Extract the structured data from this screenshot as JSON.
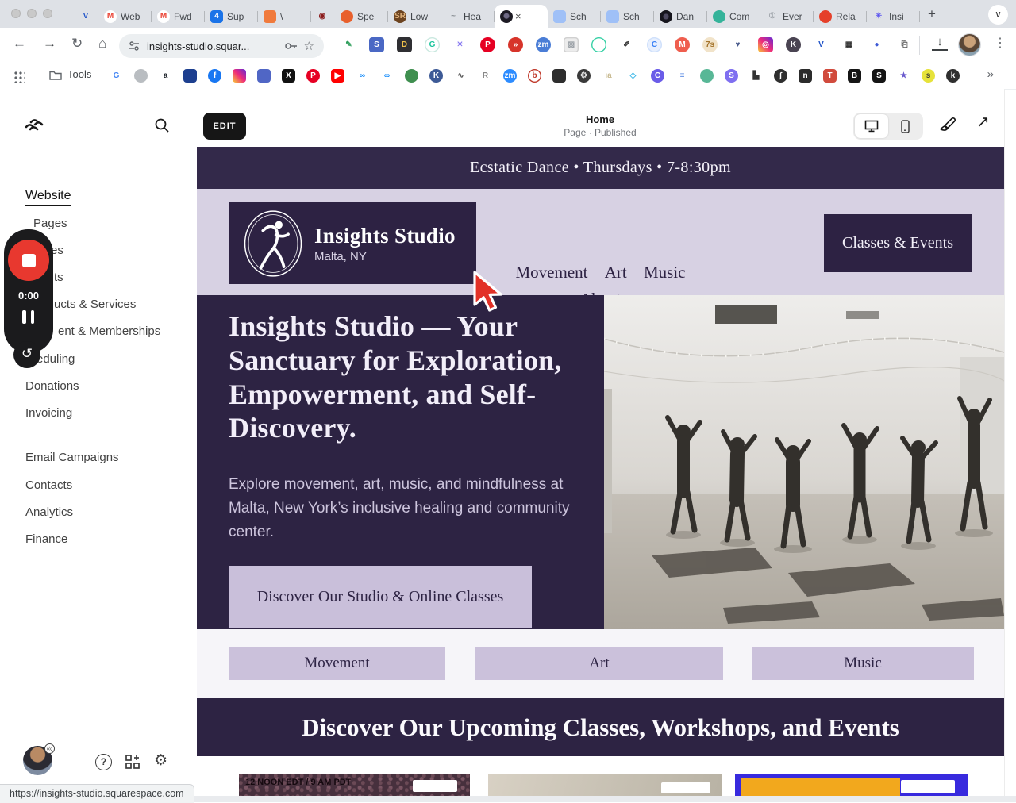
{
  "browser": {
    "tabs": [
      {
        "name": "pinned-tab-v",
        "glyph": "V",
        "fg": "#2456c9",
        "bg": "transparent",
        "label": "",
        "pinned": true
      },
      {
        "name": "tab-gmail-web",
        "glyph": "M",
        "fg": "#ea4335",
        "bg": "#ffffff",
        "label": "Web"
      },
      {
        "name": "tab-gmail-fwd",
        "glyph": "M",
        "fg": "#ea4335",
        "bg": "#ffffff",
        "label": "Fwd"
      },
      {
        "name": "tab-calendar-sup",
        "glyph": "4",
        "fg": "#ffffff",
        "bg": "#1a73e8",
        "sq": true,
        "label": "Sup"
      },
      {
        "name": "tab-orange-doc",
        "glyph": "",
        "fg": "#ffffff",
        "bg": "#f07a3c",
        "sq": true,
        "label": "\\"
      },
      {
        "name": "pinned-tab-record",
        "glyph": "◉",
        "fg": "#8b1c1c",
        "bg": "transparent",
        "label": "",
        "pinned": true
      },
      {
        "name": "tab-chat-spe",
        "glyph": "",
        "fg": "#ffffff",
        "bg": "#e8602c",
        "label": "Spe"
      },
      {
        "name": "tab-sr-low",
        "glyph": "SR",
        "fg": "#e0b27a",
        "bg": "#6d4420",
        "label": "Low"
      },
      {
        "name": "tab-wave-hea",
        "glyph": "~",
        "fg": "#8a8f94",
        "bg": "transparent",
        "label": "Hea"
      },
      {
        "name": "tab-insights-active",
        "glyph": "",
        "fg": "#8a86a0",
        "bg": "radial-gradient(circle at 50% 45%, #6f6a85 0 3px, #1d1b24 4px)",
        "label": "",
        "active": true,
        "close": "×"
      },
      {
        "name": "tab-sheet-sch-1",
        "glyph": "",
        "fg": "#1a57c2",
        "bg": "#9fc0f7",
        "sq": true,
        "label": "Sch"
      },
      {
        "name": "tab-sheet-sch-2",
        "glyph": "",
        "fg": "#1a57c2",
        "bg": "#9fc0f7",
        "sq": true,
        "label": "Sch"
      },
      {
        "name": "tab-dark-dan",
        "glyph": "",
        "fg": "#6f6a85",
        "bg": "radial-gradient(circle at 50% 50%, #4d4960 0 3px, #16151d 4px)",
        "label": "Dan"
      },
      {
        "name": "tab-leaf-com",
        "glyph": "",
        "fg": "#ffffff",
        "bg": "#35b39a",
        "label": "Com"
      },
      {
        "name": "tab-clock-ever",
        "glyph": "①",
        "fg": "#9aa0a6",
        "bg": "transparent",
        "label": "Ever"
      },
      {
        "name": "tab-red-rela",
        "glyph": "",
        "fg": "#ffffff",
        "bg": "#e5402a",
        "label": "Rela"
      },
      {
        "name": "tab-burst-insi",
        "glyph": "✳",
        "fg": "#5b54f0",
        "bg": "transparent",
        "label": "Insi"
      }
    ],
    "new_tab": "+",
    "tab_overflow": "∨",
    "nav_icons": {
      "back": "←",
      "forward": "→",
      "reload": "↻",
      "home": "⌂"
    },
    "address": {
      "url": "insights-studio.squar...",
      "star": "☆"
    },
    "extensions": [
      {
        "name": "ext-pen",
        "glyph": "✎",
        "fg": "#2e9e5b",
        "bg": "transparent"
      },
      {
        "name": "ext-blue-app",
        "glyph": "S",
        "fg": "#ffffff",
        "bg": "#4a68c4",
        "sq": true
      },
      {
        "name": "ext-dark-doc",
        "glyph": "D",
        "fg": "#f0c24b",
        "bg": "#2f2f33",
        "sq": true
      },
      {
        "name": "ext-grammarly",
        "glyph": "G",
        "fg": "#15c39a",
        "bg": "#ffffff",
        "border": "#c9e8df"
      },
      {
        "name": "ext-snowflake",
        "glyph": "✳",
        "fg": "#7c6cf0",
        "bg": "transparent"
      },
      {
        "name": "ext-pinterest",
        "glyph": "P",
        "fg": "#ffffff",
        "bg": "#e60023"
      },
      {
        "name": "ext-red-fast",
        "glyph": "»",
        "fg": "#ffffff",
        "bg": "#d7342a"
      },
      {
        "name": "ext-zoom",
        "glyph": "zm",
        "fg": "#ffffff",
        "bg": "#4a7dd6"
      },
      {
        "name": "ext-image",
        "glyph": "▨",
        "fg": "#9aa0a6",
        "bg": "#ececec",
        "sq": true,
        "border": "#d0d0d0"
      },
      {
        "name": "ext-teal-ring",
        "glyph": "",
        "fg": "#35d0a5",
        "bg": "transparent",
        "border": "#35d0a5"
      },
      {
        "name": "ext-eyedropper",
        "glyph": "✐",
        "fg": "#333333",
        "bg": "transparent"
      },
      {
        "name": "ext-c-blue",
        "glyph": "C",
        "fg": "#3b82f6",
        "bg": "#e8f0fe",
        "border": "#cfe0fb"
      },
      {
        "name": "ext-m-orange",
        "glyph": "M",
        "fg": "#ffffff",
        "bg": "#ef5e4e"
      },
      {
        "name": "ext-ts-tan",
        "glyph": "7s",
        "fg": "#a5742c",
        "bg": "#f1e3c9"
      },
      {
        "name": "ext-heart-search",
        "glyph": "♥",
        "fg": "#4a5b8c",
        "bg": "transparent"
      },
      {
        "name": "ext-instagram",
        "glyph": "◎",
        "fg": "#ffffff",
        "bg": "linear-gradient(45deg,#f9ce34,#ee2a7b,#6228d7)",
        "sq": true
      },
      {
        "name": "ext-k-dark",
        "glyph": "K",
        "fg": "#ffffff",
        "bg": "#4a4452"
      },
      {
        "name": "ext-v-blue",
        "glyph": "V",
        "fg": "#2456c9",
        "bg": "transparent"
      },
      {
        "name": "ext-grid",
        "glyph": "▦",
        "fg": "#333333",
        "bg": "transparent"
      },
      {
        "name": "ext-sphere",
        "glyph": "●",
        "fg": "#3f5bd6",
        "bg": "transparent"
      },
      {
        "name": "ext-clipboard",
        "glyph": "⎗",
        "fg": "#555555",
        "bg": "transparent"
      }
    ],
    "menu": {
      "download": "↓",
      "more": "⋮"
    },
    "bookmarks": {
      "folder_label": "Tools",
      "overflow": "»",
      "items": [
        {
          "name": "bm-google",
          "glyph": "G",
          "fg": "#4285f4",
          "bg": "transparent"
        },
        {
          "name": "bm-apple",
          "glyph": "",
          "fg": "#fff",
          "bg": "#b9bdc1"
        },
        {
          "name": "bm-amazon",
          "glyph": "a",
          "fg": "#131921",
          "bg": "transparent"
        },
        {
          "name": "bm-doc-blue",
          "glyph": "",
          "fg": "#fff",
          "bg": "#1d3f8f",
          "sq": true
        },
        {
          "name": "bm-facebook",
          "glyph": "f",
          "fg": "#ffffff",
          "bg": "#1877f2"
        },
        {
          "name": "bm-instagram",
          "glyph": "",
          "fg": "#fff",
          "bg": "linear-gradient(45deg,#f9ce34,#ee2a7b,#6228d7)",
          "sq": true
        },
        {
          "name": "bm-blue-app",
          "glyph": "",
          "fg": "#fff",
          "bg": "#5066c5",
          "sq": true
        },
        {
          "name": "bm-x",
          "glyph": "X",
          "fg": "#ffffff",
          "bg": "#111111",
          "sq": true
        },
        {
          "name": "bm-pinterest",
          "glyph": "P",
          "fg": "#ffffff",
          "bg": "#e60023"
        },
        {
          "name": "bm-youtube",
          "glyph": "▶",
          "fg": "#ffffff",
          "bg": "#ff0000",
          "sq": true
        },
        {
          "name": "bm-meta-1",
          "glyph": "∞",
          "fg": "#0082fb",
          "bg": "transparent"
        },
        {
          "name": "bm-meta-2",
          "glyph": "∞",
          "fg": "#0082fb",
          "bg": "transparent"
        },
        {
          "name": "bm-green-badge",
          "glyph": "",
          "fg": "#fff",
          "bg": "#3f8f4f"
        },
        {
          "name": "bm-k-blue",
          "glyph": "K",
          "fg": "#ffffff",
          "bg": "#3d5a96"
        },
        {
          "name": "bm-squarespace",
          "glyph": "∿",
          "fg": "#555555",
          "bg": "transparent"
        },
        {
          "name": "bm-r",
          "glyph": "R",
          "fg": "#888888",
          "bg": "transparent"
        },
        {
          "name": "bm-zoom",
          "glyph": "zm",
          "fg": "#ffffff",
          "bg": "#2d8cff"
        },
        {
          "name": "bm-b-ring",
          "glyph": "b",
          "fg": "#c0392b",
          "bg": "transparent",
          "border": "#c0392b"
        },
        {
          "name": "bm-camera",
          "glyph": "",
          "fg": "#fff",
          "bg": "#2e2e2e",
          "sq": true
        },
        {
          "name": "bm-gear",
          "glyph": "⚙",
          "fg": "#dddddd",
          "bg": "#3a3a3a"
        },
        {
          "name": "bm-text",
          "glyph": "ıa",
          "fg": "#c9bb92",
          "bg": "transparent"
        },
        {
          "name": "bm-diamond",
          "glyph": "◇",
          "fg": "#3ab7e8",
          "bg": "transparent"
        },
        {
          "name": "bm-c-purple",
          "glyph": "C",
          "fg": "#ffffff",
          "bg": "#6a5ce8"
        },
        {
          "name": "bm-lines",
          "glyph": "≡",
          "fg": "#4a7fe0",
          "bg": "transparent"
        },
        {
          "name": "bm-leaf",
          "glyph": "",
          "fg": "#fff",
          "bg": "#58b796"
        },
        {
          "name": "bm-s-purple",
          "glyph": "S",
          "fg": "#ffffff",
          "bg": "#7f6ff0"
        },
        {
          "name": "bm-blocks",
          "glyph": "▙",
          "fg": "#333333",
          "bg": "transparent"
        },
        {
          "name": "bm-s-curve",
          "glyph": "∫",
          "fg": "#ffffff",
          "bg": "#2f2f2f"
        },
        {
          "name": "bm-n",
          "glyph": "n",
          "fg": "#ffffff",
          "bg": "#2b2b2b",
          "sq": true
        },
        {
          "name": "bm-t-red",
          "glyph": "T",
          "fg": "#ffffff",
          "bg": "#d14b3d",
          "sq": true
        },
        {
          "name": "bm-b-square",
          "glyph": "B",
          "fg": "#ffffff",
          "bg": "#151515",
          "sq": true
        },
        {
          "name": "bm-s-square",
          "glyph": "S",
          "fg": "#ffffff",
          "bg": "#151515",
          "sq": true
        },
        {
          "name": "bm-star",
          "glyph": "★",
          "fg": "#6a5acd",
          "bg": "transparent"
        },
        {
          "name": "bm-s-yellow",
          "glyph": "s",
          "fg": "#333333",
          "bg": "#e6e23a"
        },
        {
          "name": "bm-k-dark",
          "glyph": "k",
          "fg": "#ffffff",
          "bg": "#2f2f2f"
        }
      ]
    }
  },
  "admin": {
    "nav": [
      {
        "label": "Website"
      },
      {
        "label": "Pages"
      },
      {
        "label": "es"
      },
      {
        "label": "ts"
      },
      {
        "label": "ucts & Services"
      },
      {
        "label": "ent & Memberships"
      },
      {
        "label": "eduling"
      },
      {
        "label": "Donations"
      },
      {
        "label": "Invoicing"
      },
      {
        "label": "Email Campaigns"
      },
      {
        "label": "Contacts"
      },
      {
        "label": "Analytics"
      },
      {
        "label": "Finance"
      }
    ],
    "recorder": {
      "time": "0:00",
      "restart": "↺"
    },
    "icons": {
      "help": "?",
      "gear": "⚙"
    },
    "status_url": "https://insights-studio.squarespace.com"
  },
  "preview": {
    "edit": "EDIT",
    "page_title": "Home",
    "page_status": "Page · Published",
    "open_arrow": "↗"
  },
  "site": {
    "announcement": "Ecstatic Dance • Thursdays • 7-8:30pm",
    "brand": {
      "title": "Insights Studio",
      "subtitle": "Malta, NY"
    },
    "nav": [
      "Movement",
      "Art",
      "Music",
      "About"
    ],
    "header_cta": "Classes & Events",
    "hero": {
      "title": "Insights Studio — Your Sanctuary for Exploration, Empowerment, and Self-Discovery.",
      "body": "Explore movement, art, music, and mindfulness at Malta, New York’s inclusive healing and community center.",
      "cta": "Discover Our Studio & Online Classes"
    },
    "categories": [
      "Movement",
      "Art",
      "Music"
    ],
    "events_heading": "Discover Our Upcoming Classes, Workshops, and Events",
    "cards": [
      {
        "text": "12 NOON EDT / 9 AM PDT"
      },
      {
        "text": ""
      },
      {
        "text": ""
      }
    ]
  }
}
